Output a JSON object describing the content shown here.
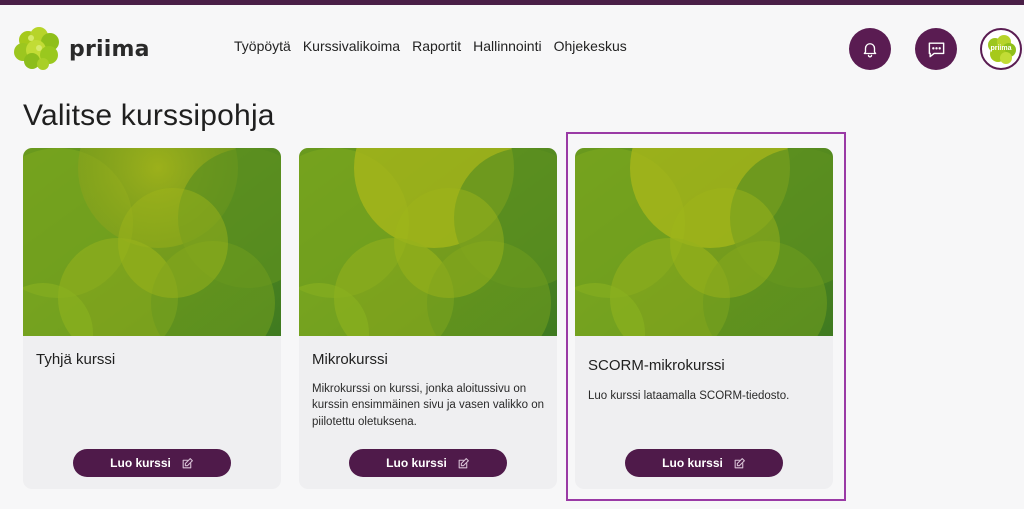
{
  "brand": {
    "name": "priima",
    "accent": "#5a1c52",
    "highlight": "#9a3aa5"
  },
  "nav": {
    "items": [
      {
        "label": "Työpöytä"
      },
      {
        "label": "Kurssivalikoima"
      },
      {
        "label": "Raportit"
      },
      {
        "label": "Hallinnointi"
      },
      {
        "label": "Ohjekeskus"
      }
    ]
  },
  "header_icons": {
    "notifications": "bell-icon",
    "messages": "chat-icon",
    "profile": "avatar"
  },
  "avatar": {
    "text": "priima"
  },
  "page": {
    "title": "Valitse kurssipohja"
  },
  "cards": [
    {
      "title": "Tyhjä kurssi",
      "description": "",
      "button_label": "Luo kurssi",
      "button_icon": "edit-icon"
    },
    {
      "title": "Mikrokurssi",
      "description": "Mikrokurssi on kurssi, jonka aloitussivu on kurssin ensimmäinen sivu ja vasen valikko on piilotettu oletuksena.",
      "button_label": "Luo kurssi",
      "button_icon": "edit-icon"
    },
    {
      "title": "SCORM-mikrokurssi",
      "description": "Luo kurssi lataamalla SCORM-tiedosto.",
      "button_label": "Luo kurssi",
      "button_icon": "edit-icon",
      "selected": true
    }
  ]
}
